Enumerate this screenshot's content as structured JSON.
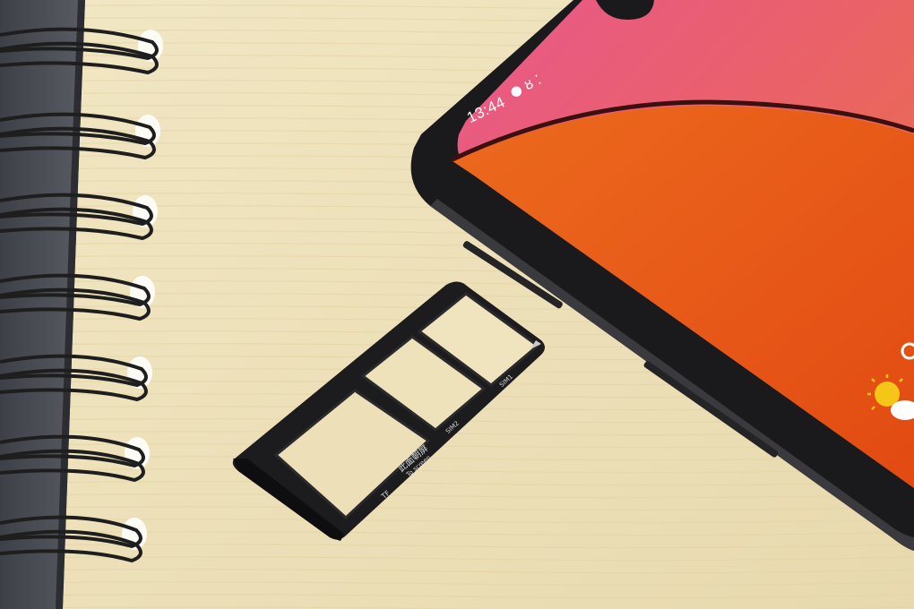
{
  "photo": {
    "subject": "phone-sim-tray-on-notebook"
  },
  "phone": {
    "status_bar": {
      "time": "13:44",
      "icons": [
        "notification-dot-icon",
        "signal-icon",
        "dots-icon"
      ]
    },
    "colors": {
      "screen_top": "#e85a85",
      "screen_main": "#e8531a",
      "frame": "#1a1a1c"
    }
  },
  "sim_tray": {
    "slot_labels": {
      "sim1": "SIM1",
      "sim2": "SIM2",
      "tf": "TF",
      "chinese": "此面朝屏",
      "english": "To screen"
    },
    "color": "#1c1c1e"
  },
  "notebook": {
    "paper_color": "#efe3bd",
    "cover_color": "#4b4d55",
    "coil_color": "#1e1e1e"
  }
}
